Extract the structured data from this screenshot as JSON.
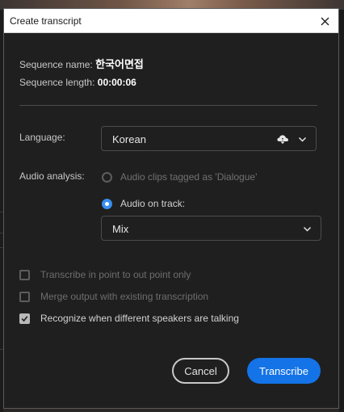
{
  "dialog": {
    "title": "Create transcript",
    "close_icon": "close-icon"
  },
  "sequence": {
    "name_label": "Sequence name:",
    "name_value": "한국어면접",
    "length_label": "Sequence length:",
    "length_value": "00:00:06"
  },
  "language": {
    "label": "Language:",
    "selected": "Korean",
    "download_icon": "cloud-download-icon"
  },
  "audio_analysis": {
    "label": "Audio analysis:",
    "options": [
      {
        "label": "Audio clips tagged as 'Dialogue'",
        "selected": false,
        "enabled": false
      },
      {
        "label": "Audio on track:",
        "selected": true,
        "enabled": true
      }
    ],
    "track_selected": "Mix"
  },
  "options": [
    {
      "label": "Transcribe in point to out point only",
      "checked": false,
      "enabled": false
    },
    {
      "label": "Merge output with existing transcription",
      "checked": false,
      "enabled": false
    },
    {
      "label": "Recognize when different speakers are talking",
      "checked": true,
      "enabled": true
    }
  ],
  "buttons": {
    "cancel": "Cancel",
    "transcribe": "Transcribe"
  },
  "colors": {
    "accent": "#1473e6",
    "radio_accent": "#378ef0",
    "dialog_bg": "#1f1f1f"
  }
}
